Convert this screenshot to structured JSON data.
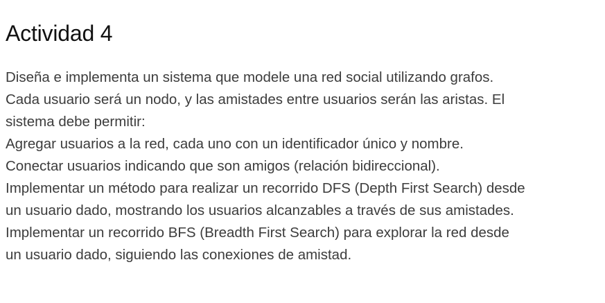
{
  "document": {
    "title": "Actividad 4",
    "lines": [
      "Diseña e implementa un sistema que modele una red social utilizando grafos.",
      "Cada usuario será un nodo, y las amistades entre usuarios serán las aristas. El",
      "sistema debe permitir:",
      "Agregar usuarios a la red, cada uno con un identificador único y nombre.",
      "Conectar usuarios indicando que son amigos (relación bidireccional).",
      "Implementar un método para realizar un recorrido DFS (Depth First Search) desde",
      "un usuario dado, mostrando los usuarios alcanzables a través de sus amistades.",
      "Implementar un recorrido BFS (Breadth First Search) para explorar la red desde",
      "un usuario dado, siguiendo las conexiones de amistad."
    ]
  }
}
